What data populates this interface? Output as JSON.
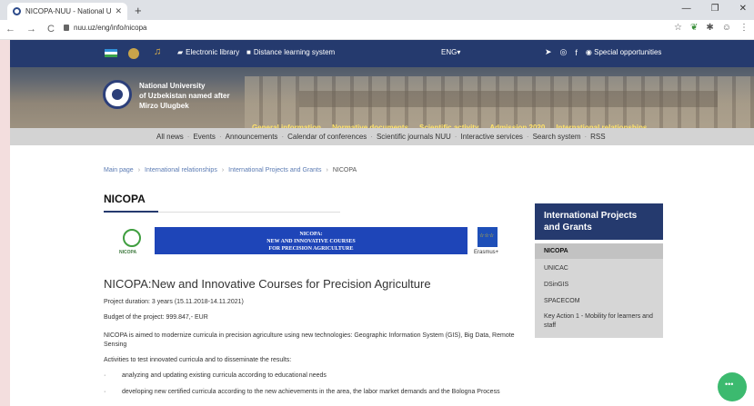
{
  "browser": {
    "tab_title": "NICOPA-NUU - National Univers",
    "url": "nuu.uz/eng/info/nicopa"
  },
  "site": {
    "top_links": [
      "Electronic library",
      "Distance learning system"
    ],
    "language": "ENG",
    "special": "Special opportunities",
    "university_name": [
      "National University",
      "of Uzbekistan named after",
      "Mirzo Ulugbek"
    ],
    "main_nav": [
      "General information",
      "Normative documents",
      "Scientific activity",
      "Admission 2020",
      "International relationships"
    ],
    "sub_nav": [
      "All news",
      "Events",
      "Announcements",
      "Calendar of conferences",
      "Scientific journals NUU",
      "Interactive services",
      "Search system",
      "RSS"
    ]
  },
  "breadcrumb": [
    "Main page",
    "International relationships",
    "International Projects and Grants",
    "NICOPA"
  ],
  "page_title": "NICOPA",
  "banner": {
    "logo_label": "NICOPA",
    "lines": [
      "NICOPA:",
      "NEW AND INNOVATIVE COURSES",
      "FOR PRECISION AGRICULTURE"
    ],
    "partner": "Erasmus+"
  },
  "article": {
    "heading": "NICOPA:New and Innovative Courses for Precision Agriculture",
    "duration": "Project duration: 3 years (15.11.2018-14.11.2021)",
    "budget": "Budget of the project:  999.847,- EUR",
    "aim": "NICOPA is aimed to modernize curricula in precision agriculture using new technologies: Geographic Information System (GIS), Big Data, Remote Sensing",
    "activities": "Activities to test innovated curricula and to disseminate the results:",
    "bullets": [
      "analyzing and updating existing curricula according to educational needs",
      "developing new certified curricula according to the new achievements in the area, the labor market demands and the Bologna Process"
    ]
  },
  "sidebar": {
    "title": "International Projects and Grants",
    "items": [
      "NICOPA",
      "UNICAC",
      "DSinGIS",
      "SPACECOM",
      "Key Action 1 - Mobility for learners and staff"
    ]
  }
}
